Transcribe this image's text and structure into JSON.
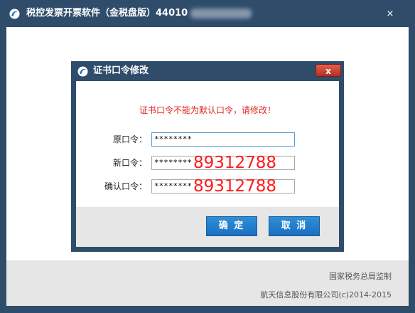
{
  "main_window": {
    "title": "税控发票开票软件（金税盘版）44010",
    "close_glyph": "×",
    "footer": {
      "supervisor": "国家税务总局监制",
      "copyright": "航天信息股份有限公司(c)2014-2015"
    }
  },
  "dialog": {
    "title": "证书口令修改",
    "close_glyph": "x",
    "message": "证书口令不能为默认口令，请修改！",
    "fields": {
      "original": {
        "label": "原口令：",
        "value": "********"
      },
      "new": {
        "label": "新口令：",
        "value": "********"
      },
      "confirm": {
        "label": "确认口令：",
        "value": "********"
      }
    },
    "overlay_number": "89312788",
    "buttons": {
      "ok": "确 定",
      "cancel": "取 消"
    }
  },
  "colors": {
    "frame": "#2f4d6b",
    "accent_button": "#1a6fc0",
    "warning_text": "#e3231f",
    "overlay_text": "#ff1a1a",
    "close_button": "#c0392b"
  },
  "icons": {
    "app": "app-logo-icon",
    "dialog": "app-logo-icon"
  }
}
